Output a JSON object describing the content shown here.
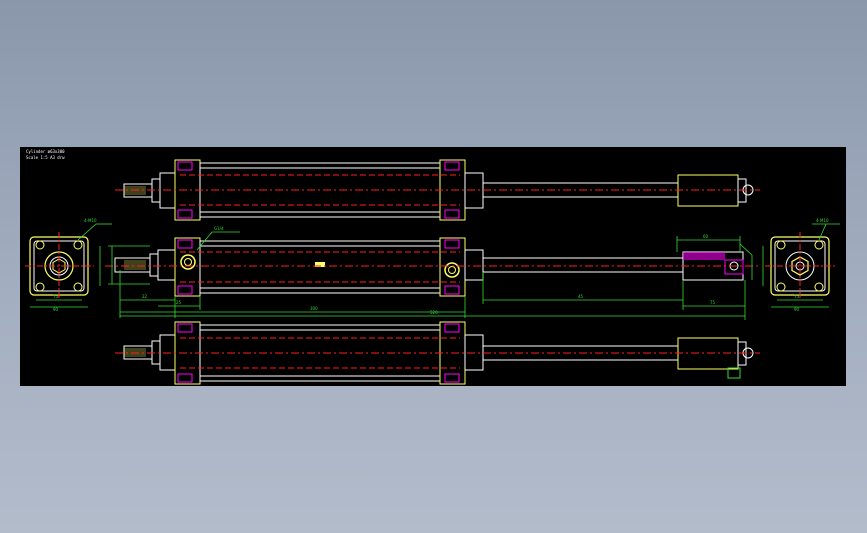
{
  "drawing": {
    "title_line_1": "Cylinder ø63x300",
    "title_line_2": "Scale 1:5  A3 drw",
    "colors": {
      "sheet": "#000000",
      "outline": "#ffffff",
      "part": "#ffff66",
      "centerline": "#ff2020",
      "hidden": "#ff2020",
      "dimension": "#33dd33",
      "accent": "#ff00ff",
      "background_top": "#8a97ab",
      "background_bottom": "#b3bccb"
    },
    "dimensions": {
      "front_flange_width": "ø63",
      "front_flange_bolt": "4-M10",
      "rear_flange_width": "ø63",
      "rear_flange_bolt": "4-M10",
      "rod_length": "22",
      "stroke": "300",
      "total_length": "520",
      "rod_end_length": "45",
      "rod_end_width": "60",
      "thread_callout": "G1/4",
      "front_width_a": "75",
      "front_width_b": "90",
      "rear_width_a": "75",
      "rear_width_b": "90",
      "end_dim": "75",
      "small_dim": "25"
    }
  }
}
